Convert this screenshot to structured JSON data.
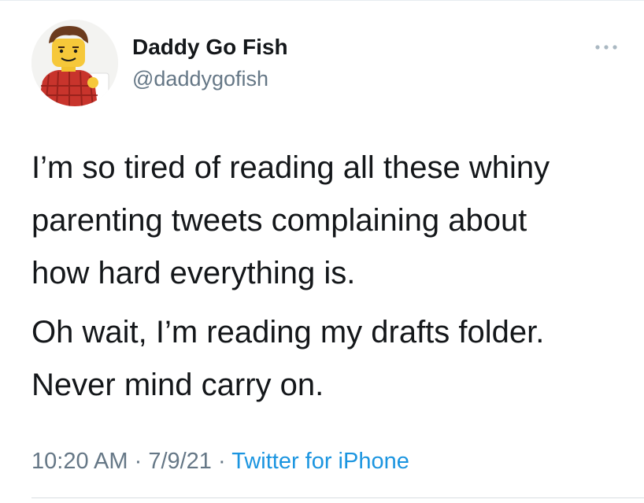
{
  "tweet": {
    "author": {
      "display_name": "Daddy Go Fish",
      "handle": "@daddygofish"
    },
    "more_icon": "more-horizontal-icon",
    "avatar_icon": "lego-minifigure-avatar",
    "body": {
      "paragraph_1": "I’m so tired of reading all these whiny\nparenting tweets complaining about\nhow hard everything is.",
      "paragraph_2": "Oh wait, I’m reading my drafts folder.\nNever mind carry on."
    },
    "meta": {
      "time": "10:20 AM",
      "separator_1": " · ",
      "date": "7/9/21",
      "separator_2": " · ",
      "source": "Twitter for iPhone"
    }
  },
  "colors": {
    "text_primary": "#14171a",
    "text_secondary": "#657786",
    "link": "#1b95e0",
    "border": "#e6ecf0"
  }
}
